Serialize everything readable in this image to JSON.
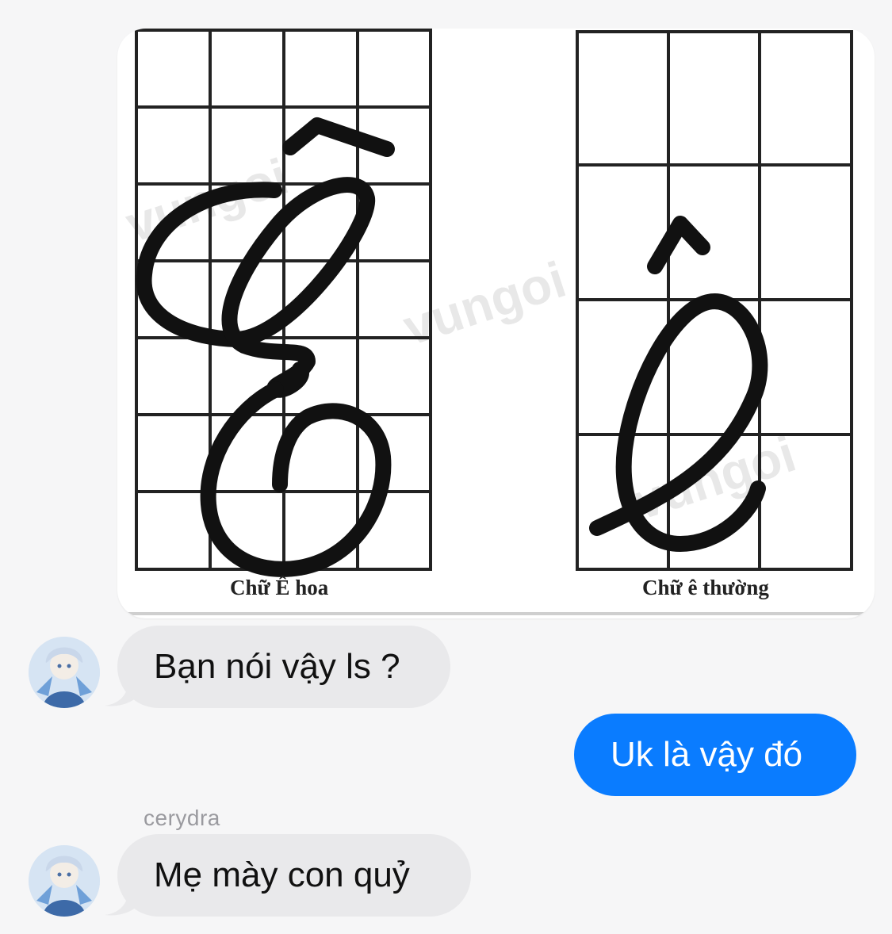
{
  "shared_image": {
    "caption_left": "Chữ Ê hoa",
    "caption_right": "Chữ ê thường",
    "watermark": "vungoi.vn"
  },
  "messages": [
    {
      "direction": "incoming",
      "text": "Bạn nói vậy ls ?"
    },
    {
      "direction": "outgoing",
      "text": "Uk là vậy đó"
    },
    {
      "direction": "incoming",
      "sender": "cerydra",
      "text": "Mẹ mày con quỷ"
    }
  ],
  "colors": {
    "background": "#f6f6f7",
    "incoming_bubble": "#e9e9eb",
    "outgoing_bubble": "#0a7cff"
  }
}
